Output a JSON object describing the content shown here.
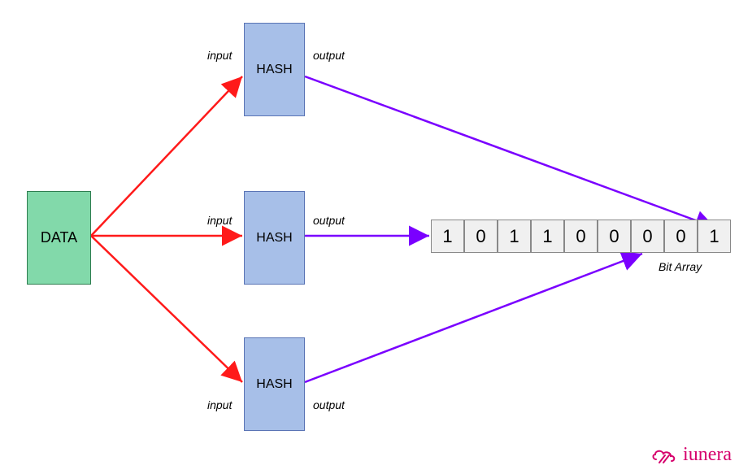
{
  "data_block": {
    "label": "DATA"
  },
  "hashes": [
    {
      "label": "HASH",
      "input_label": "input",
      "output_label": "output"
    },
    {
      "label": "HASH",
      "input_label": "input",
      "output_label": "output"
    },
    {
      "label": "HASH",
      "input_label": "input",
      "output_label": "output"
    }
  ],
  "bit_array": {
    "bits": [
      "1",
      "0",
      "1",
      "1",
      "0",
      "0",
      "0",
      "0",
      "1"
    ],
    "caption": "Bit Array"
  },
  "colors": {
    "data_fill": "#82d9aa",
    "hash_fill": "#a7bfe8",
    "arrow_red": "#ff1a1a",
    "arrow_purple": "#7a00ff",
    "brand": "#d6006c"
  },
  "brand": {
    "name": "iunera"
  },
  "chart_data": {
    "type": "diagram",
    "title": "Bloom filter / hash-to-bit-array schematic",
    "nodes": [
      {
        "id": "data",
        "kind": "source",
        "label": "DATA"
      },
      {
        "id": "hash1",
        "kind": "hash",
        "label": "HASH"
      },
      {
        "id": "hash2",
        "kind": "hash",
        "label": "HASH"
      },
      {
        "id": "hash3",
        "kind": "hash",
        "label": "HASH"
      },
      {
        "id": "bits",
        "kind": "bit-array",
        "values": [
          1,
          0,
          1,
          1,
          0,
          0,
          0,
          0,
          1
        ],
        "caption": "Bit Array"
      }
    ],
    "edges": [
      {
        "from": "data",
        "to": "hash1",
        "label": "input",
        "color": "red"
      },
      {
        "from": "data",
        "to": "hash2",
        "label": "input",
        "color": "red"
      },
      {
        "from": "data",
        "to": "hash3",
        "label": "input",
        "color": "red"
      },
      {
        "from": "hash1",
        "to": "bits",
        "label": "output",
        "color": "purple",
        "target_index": 8
      },
      {
        "from": "hash2",
        "to": "bits",
        "label": "output",
        "color": "purple",
        "target_index": 0
      },
      {
        "from": "hash3",
        "to": "bits",
        "label": "output",
        "color": "purple",
        "target_index": 6
      }
    ]
  }
}
